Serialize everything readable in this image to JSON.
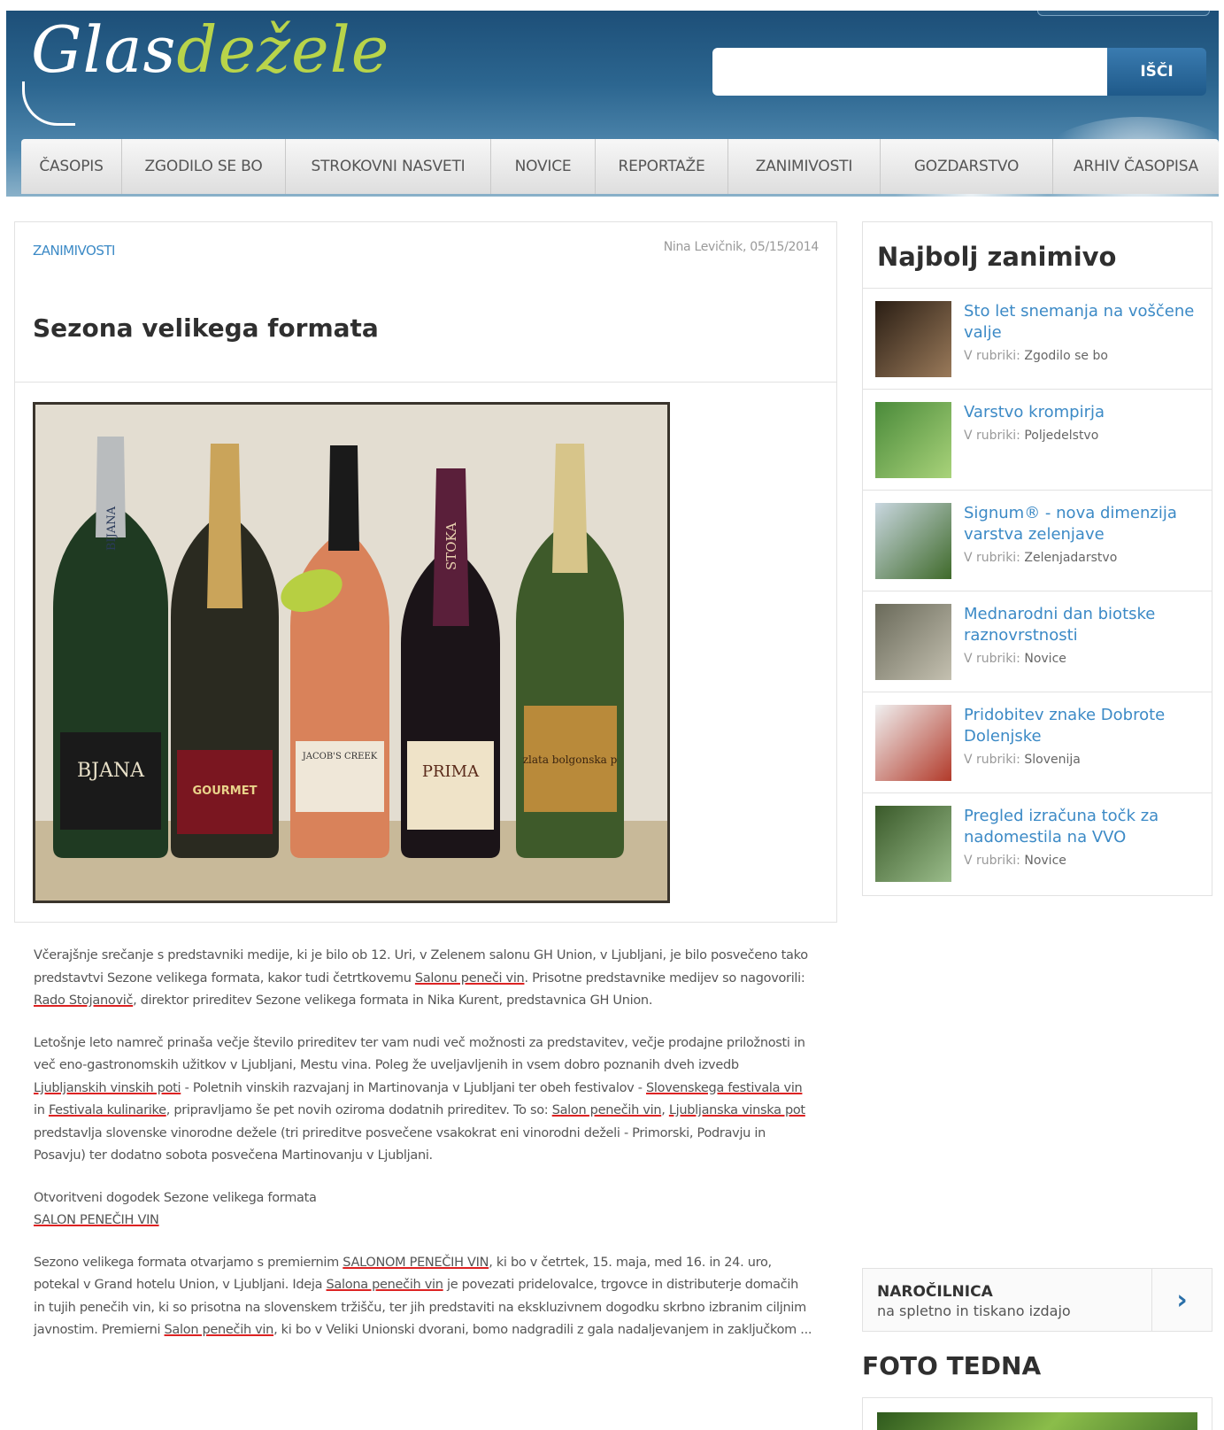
{
  "header": {
    "logo_part1": "Glas",
    "logo_part2": "dežele",
    "search_placeholder": "",
    "search_button": "IŠČI"
  },
  "nav": {
    "items": [
      {
        "label": "ČASOPIS",
        "w": 114
      },
      {
        "label": "ZGODILO SE BO",
        "w": 185
      },
      {
        "label": "STROKOVNI NASVETI",
        "w": 232
      },
      {
        "label": "NOVICE",
        "w": 118
      },
      {
        "label": "REPORTAŽE",
        "w": 150
      },
      {
        "label": "ZANIMIVOSTI",
        "w": 172
      },
      {
        "label": "GOZDARSTVO",
        "w": 195
      },
      {
        "label": "ARHIV ČASOPISA",
        "w": 187
      }
    ]
  },
  "article": {
    "category": "ZANIMIVOSTI",
    "byline": "Nina Levičnik, 05/15/2014",
    "title": "Sezona velikega formata",
    "p1": [
      {
        "t": "Včerajšnje srečanje s predstavniki medije, ki je bilo ob 12. Uri, v Zelenem salonu GH Union, v Ljubljani, je bilo posvečeno tako predstavtvi Sezone velikega formata, kakor tudi četrtkovemu "
      },
      {
        "t": "Salonu peneči vin",
        "link": true
      },
      {
        "t": ". Prisotne predstavnike medijev so nagovorili: "
      },
      {
        "t": "Rado Stojanovič",
        "link": true
      },
      {
        "t": ", direktor prireditev Sezone velikega formata in Nika Kurent, predstavnica GH Union."
      }
    ],
    "p2": [
      {
        "t": "Letošnje leto namreč prinaša večje število prireditev ter vam nudi več možnosti za predstavitev, večje prodajne priložnosti in več eno-gastronomskih užitkov v Ljubljani, Mestu vina. Poleg že uveljavljenih in vsem dobro poznanih dveh izvedb "
      },
      {
        "t": "Ljubljanskih vinskih poti",
        "link": true
      },
      {
        "t": " - Poletnih vinskih razvajanj in Martinovanja v Ljubljani ter obeh festivalov - "
      },
      {
        "t": "Slovenskega festivala vin",
        "link": true
      },
      {
        "t": " in "
      },
      {
        "t": "Festivala kulinarike",
        "link": true
      },
      {
        "t": ", pripravljamo še pet novih oziroma dodatnih prireditev. To so: "
      },
      {
        "t": "Salon penečih vin",
        "link": true
      },
      {
        "t": ", "
      },
      {
        "t": "Ljubljanska vinska pot",
        "link": true
      },
      {
        "t": " predstavlja slovenske vinorodne dežele (tri prireditve posvečene vsakokrat eni vinorodni deželi - Primorski, Podravju in Posavju) ter dodatno sobota posvečena Martinovanju v Ljubljani."
      }
    ],
    "p3_line1": "Otvoritveni dogodek Sezone velikega formata",
    "p3_line2": "SALON PENEČIH VIN",
    "p4": [
      {
        "t": "Sezono velikega formata otvarjamo s premiernim "
      },
      {
        "t": "SALONOM PENEČIH VIN",
        "link": true
      },
      {
        "t": ", ki bo v četrtek, 15. maja, med 16. in 24. uro, potekal v Grand hotelu Union, v Ljubljani. Ideja "
      },
      {
        "t": "Salona penečih vin",
        "link": true
      },
      {
        "t": " je povezati pridelovalce, trgovce in distributerje domačih in tujih penečih vin, ki so prisotna na slovenskem tržišču, ter jih predstaviti na ekskluzivnem dogodku skrbno izbranim ciljnim javnostim. Premierni "
      },
      {
        "t": "Salon penečih vin",
        "link": true
      },
      {
        "t": ", ki bo v Veliki Unionski dvorani, bomo nadgradili z gala nadaljevanjem in zaključkom ..."
      }
    ],
    "bottle_labels": [
      "BIJANA",
      "BJANA",
      "GOURMET",
      "JACOB'S CREEK",
      "STOKA",
      "PRIMA",
      "zlata bolgonska p"
    ]
  },
  "sidebar": {
    "title": "Najbolj zanimivo",
    "rubric_prefix": "V rubriki:",
    "items": [
      {
        "title": "Sto let snemanja na voščene valje",
        "rubric": "Zgodilo se bo",
        "lines": 2
      },
      {
        "title": "Varstvo krompirja",
        "rubric": "Poljedelstvo",
        "lines": 1
      },
      {
        "title": "Signum® - nova dimenzija varstva zelenjave",
        "rubric": "Zelenjadarstvo",
        "lines": 2
      },
      {
        "title": "Mednarodni dan biotske raznovrstnosti",
        "rubric": "Novice",
        "lines": 2
      },
      {
        "title": "Pridobitev znake Dobrote Dolenjske",
        "rubric": "Slovenija",
        "lines": 2
      },
      {
        "title": "Pregled izračuna točk za nadomestila na VVO",
        "rubric": "Novice",
        "lines": 2
      }
    ],
    "narocilnica_title": "NAROČILNICA",
    "narocilnica_sub": "na spletno in tiskano izdajo",
    "foto_title": "FOTO TEDNA"
  }
}
